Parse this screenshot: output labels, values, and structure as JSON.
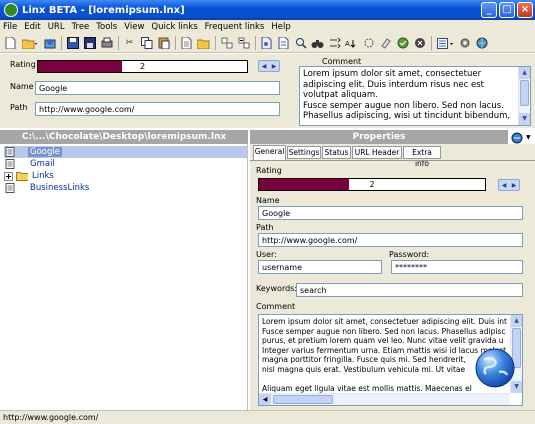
{
  "window": {
    "title": "Linx BETA - [loremipsum.lnx]"
  },
  "menu": [
    "File",
    "Edit",
    "URL",
    "Tree",
    "Tools",
    "View",
    "Quick links",
    "Frequent links",
    "Help"
  ],
  "top": {
    "rating_label": "Rating",
    "rating_value": "2",
    "rating_fraction": 0.4,
    "name_label": "Name",
    "name_value": "Google",
    "path_label": "Path",
    "path_value": "http://www.google.com/",
    "comment_label": "Comment",
    "comment_lines": [
      "Lorem ipsum dolor sit amet, consectetuer",
      "adipiscing elit. Duis interdum risus nec est",
      "volutpat aliquam.",
      "Fusce semper augue non libero. Sed non lacus.",
      "Phasellus adipiscing, wisi ut tincidunt bibendum,"
    ]
  },
  "tree": {
    "header": "C:\\...\\Chocolate\\Desktop\\loremipsum.lnx",
    "items": [
      {
        "label": "Google",
        "selected": true,
        "type": "link"
      },
      {
        "label": "Gmail",
        "selected": false,
        "type": "link"
      },
      {
        "label": "Links",
        "selected": false,
        "type": "folder"
      },
      {
        "label": "BusinessLinks",
        "selected": false,
        "type": "link"
      }
    ]
  },
  "properties": {
    "header": "Properties",
    "tabs": [
      "General",
      "Settings",
      "Status",
      "URL Header",
      "Extra info"
    ],
    "rating_label": "Rating",
    "rating_value": "2",
    "rating_fraction": 0.4,
    "name_label": "Name",
    "name_value": "Google",
    "path_label": "Path",
    "path_value": "http://www.google.com/",
    "user_label": "User:",
    "user_value": "username",
    "password_label": "Password:",
    "password_value": "********",
    "keywords_label": "Keywords:",
    "keywords_value": "search",
    "comment_label": "Comment",
    "comment_lines": [
      "Lorem ipsum dolor sit amet, consectetuer adipiscing elit. Duis int",
      "Fusce semper augue non libero. Sed non lacus. Phasellus adipisc",
      "purus, et pretium lorem quam vel leo. Nunc vitae velit gravida u",
      "Integer varius fermentum urna. Etiam mattis wisi id lacus molest",
      "magna porttitor fringilla. Fusce quis mi. Sed hendrerit,",
      "nisl magna quis erat. Vestibulum vehicula mi. Ut vitae",
      "",
      "Aliquam eget ligula vitae est mollis mattis. Maecenas el"
    ]
  },
  "status": {
    "text": "http://www.google.com/"
  }
}
